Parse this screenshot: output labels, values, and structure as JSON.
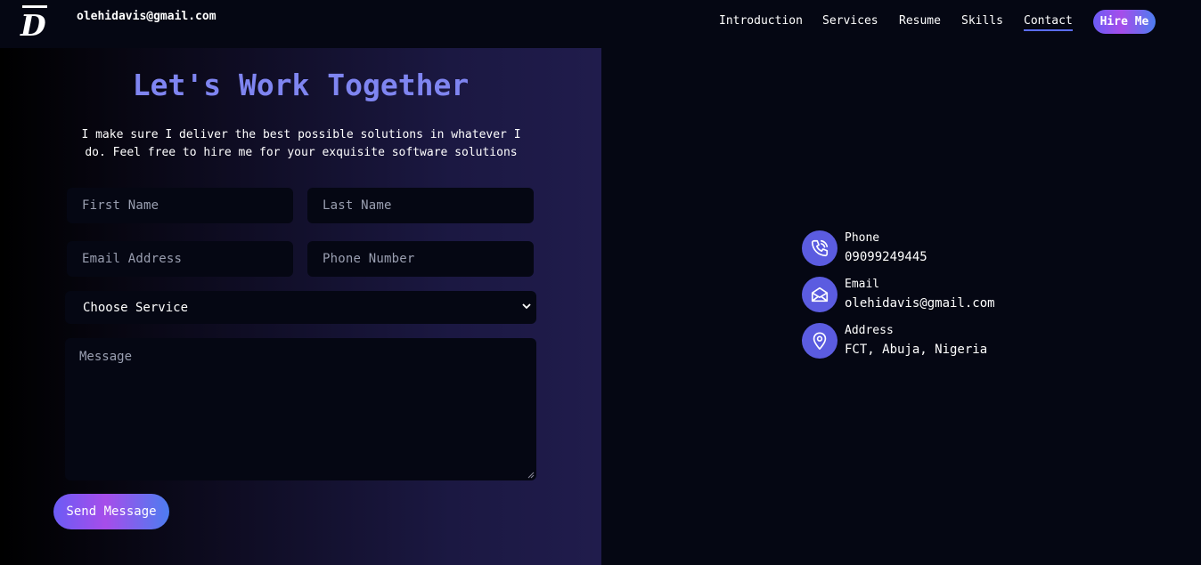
{
  "header": {
    "logo_letter": "D",
    "email": "olehidavis@gmail.com",
    "nav": [
      {
        "label": "Introduction"
      },
      {
        "label": "Services"
      },
      {
        "label": "Resume"
      },
      {
        "label": "Skills"
      },
      {
        "label": "Contact",
        "active": true
      }
    ],
    "hire_label": "Hire Me"
  },
  "form": {
    "title": "Let's Work Together",
    "subtitle": "I make sure I deliver the best possible solutions in whatever I do. Feel free to hire me for your exquisite software solutions",
    "first_name_placeholder": "First Name",
    "last_name_placeholder": "Last Name",
    "email_placeholder": "Email Address",
    "phone_placeholder": "Phone Number",
    "service_selected": "Choose Service",
    "message_placeholder": "Message",
    "send_label": "Send Message"
  },
  "contact": [
    {
      "label": "Phone",
      "value": "09099249445",
      "icon": "phone-icon"
    },
    {
      "label": "Email",
      "value": "olehidavis@gmail.com",
      "icon": "mail-icon"
    },
    {
      "label": "Address",
      "value": "FCT, Abuja, Nigeria",
      "icon": "location-icon"
    }
  ],
  "colors": {
    "background": "#050713",
    "accent": "#7f85f1",
    "icon_circle": "#5b5ce0",
    "gradient_start": "#6b5cf5",
    "gradient_mid": "#a64dea",
    "gradient_end": "#4d7df0"
  }
}
